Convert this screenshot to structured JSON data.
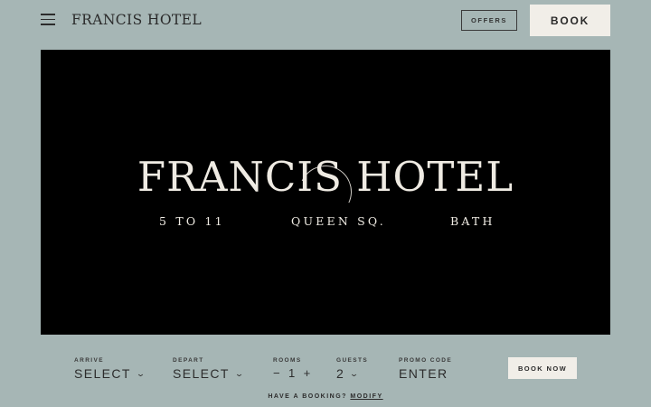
{
  "header": {
    "brand": "FRANCIS HOTEL",
    "offers_label": "OFFERS",
    "book_label": "BOOK"
  },
  "hero": {
    "title": "FRANCIS HOTEL",
    "address_parts": [
      "5 TO 11",
      "QUEEN SQ.",
      "BATH"
    ],
    "loading": true
  },
  "booking": {
    "arrive": {
      "label": "ARRIVE",
      "value": "SELECT"
    },
    "depart": {
      "label": "DEPART",
      "value": "SELECT"
    },
    "rooms": {
      "label": "ROOMS",
      "value": "1",
      "minus": "−",
      "plus": "+"
    },
    "guests": {
      "label": "GUESTS",
      "value": "2"
    },
    "promo": {
      "label": "PROMO CODE",
      "placeholder": "ENTER"
    },
    "book_now_label": "BOOK NOW",
    "have_booking_text": "HAVE A BOOKING?",
    "modify_label": "MODIFY"
  },
  "colors": {
    "background": "#a6b6b5",
    "button_light": "#f1eee8",
    "hero_bg": "#000000",
    "hero_text": "#efebe3"
  }
}
